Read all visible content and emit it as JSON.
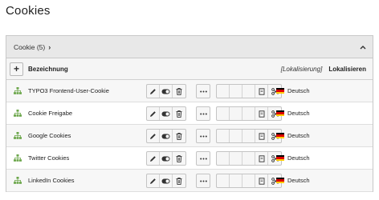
{
  "page": {
    "title": "Cookies"
  },
  "panel": {
    "title": "Cookie (5)",
    "chevron": "›",
    "collapse_icon": "chevron-up-icon"
  },
  "columns": {
    "add_label": "+",
    "name": "Bezeichnung",
    "localization": "[Lokalisierung]",
    "localize": "Lokalisieren"
  },
  "records": [
    {
      "title": "TYPO3 Frontend-User-Cookie",
      "language": "Deutsch"
    },
    {
      "title": "Cookie Freigabe",
      "language": "Deutsch"
    },
    {
      "title": "Google Cookies",
      "language": "Deutsch"
    },
    {
      "title": "Twitter Cookies",
      "language": "Deutsch"
    },
    {
      "title": "LinkedIn Cookies",
      "language": "Deutsch"
    }
  ],
  "colors": {
    "tree_icon": "#6ba64a",
    "flag": [
      "#000000",
      "#dd0000",
      "#ffcc00"
    ]
  }
}
